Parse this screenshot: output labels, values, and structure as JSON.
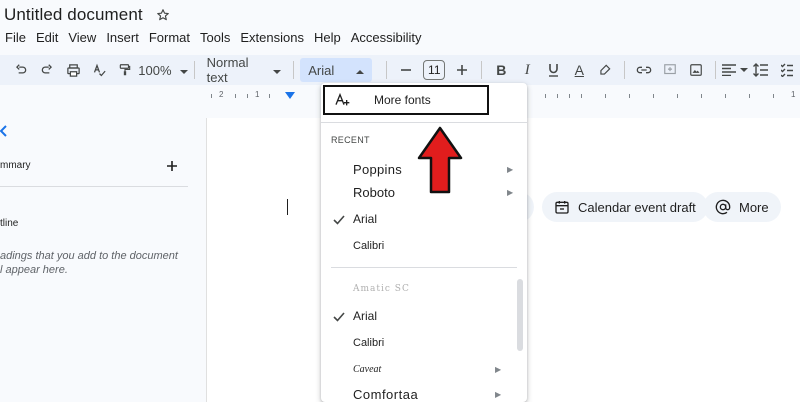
{
  "app": {
    "doc_title": "Untitled document"
  },
  "menu": [
    "File",
    "Edit",
    "View",
    "Insert",
    "Format",
    "Tools",
    "Extensions",
    "Help",
    "Accessibility"
  ],
  "toolbar": {
    "zoom": "100%",
    "style": "Normal text",
    "font": "Arial",
    "font_size": "11",
    "bold": "B",
    "italic": "I",
    "text_color": "A"
  },
  "ruler": {
    "numbers": [
      "2",
      "1",
      "1"
    ]
  },
  "sidebar": {
    "tab_icon": "arrow-left-icon",
    "summary_label": "mmary",
    "outline_label": "tline",
    "hint_line1": "adings that you add to the document",
    "hint_line2": "l appear here."
  },
  "chips": {
    "calendar": "Calendar event draft",
    "more": "More"
  },
  "font_menu": {
    "more_fonts": "More fonts",
    "recent_header": "RECENT",
    "recent": [
      {
        "label": "Poppins",
        "checked": false,
        "submenu": true
      },
      {
        "label": "Roboto",
        "checked": false,
        "submenu": true
      },
      {
        "label": "Arial",
        "checked": true,
        "submenu": false
      },
      {
        "label": "Calibri",
        "checked": false,
        "submenu": false
      }
    ],
    "all": [
      {
        "label": "Amatic SC",
        "checked": false,
        "submenu": false
      },
      {
        "label": "Arial",
        "checked": true,
        "submenu": false
      },
      {
        "label": "Calibri",
        "checked": false,
        "submenu": false
      },
      {
        "label": "Caveat",
        "checked": false,
        "submenu": true
      },
      {
        "label": "Comfortaa",
        "checked": false,
        "submenu": true
      }
    ]
  },
  "colors": {
    "toolbar_bg": "#edf2fa",
    "font_select_bg": "#d3e3fd",
    "accent": "#1a73e8",
    "annotation_red": "#e11d1d"
  }
}
